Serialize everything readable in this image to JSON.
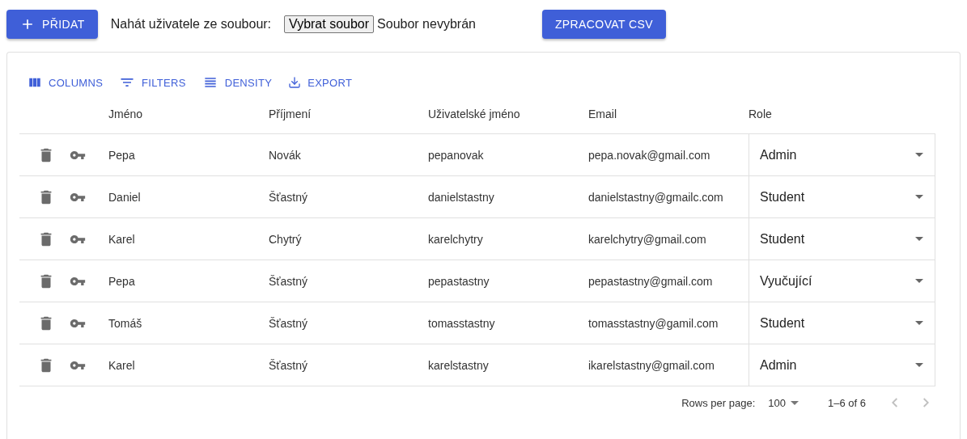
{
  "top_bar": {
    "add_button": "PŘIDAT",
    "upload_label": "Nahát uživatele ze soubour:",
    "file_button": "Vybrat soubor",
    "file_status": "Soubor nevybrán",
    "process_button": "ZPRACOVAT CSV"
  },
  "toolbar": [
    {
      "kind": "columns",
      "label": "COLUMNS"
    },
    {
      "kind": "filters",
      "label": "FILTERS"
    },
    {
      "kind": "density",
      "label": "DENSITY"
    },
    {
      "kind": "export",
      "label": "EXPORT"
    }
  ],
  "table": {
    "columns": [
      "Jméno",
      "Příjmení",
      "Uživatelské jméno",
      "Email",
      "Role"
    ],
    "rows": [
      {
        "first_name": "Pepa",
        "last_name": "Novák",
        "username": "pepanovak",
        "email": "pepa.novak@gmail.com",
        "role": "Admin"
      },
      {
        "first_name": "Daniel",
        "last_name": "Šťastný",
        "username": "danielstastny",
        "email": "danielstastny@gmailc.com",
        "role": "Student"
      },
      {
        "first_name": "Karel",
        "last_name": "Chytrý",
        "username": "karelchytry",
        "email": "karelchytry@gmail.com",
        "role": "Student"
      },
      {
        "first_name": "Pepa",
        "last_name": "Šťastný",
        "username": "pepastastny",
        "email": "pepastastny@gmail.com",
        "role": "Vyučující"
      },
      {
        "first_name": "Tomáš",
        "last_name": "Šťastný",
        "username": "tomasstastny",
        "email": "tomasstastny@gamil.com",
        "role": "Student"
      },
      {
        "first_name": "Karel",
        "last_name": "Šťastný",
        "username": "karelstastny",
        "email": "ikarelstastny@gmail.com",
        "role": "Admin"
      }
    ]
  },
  "pagination": {
    "rows_per_page_label": "Rows per page:",
    "rows_per_page": "100",
    "range": "1–6 of 6",
    "prev_disabled": true,
    "next_disabled": true
  }
}
